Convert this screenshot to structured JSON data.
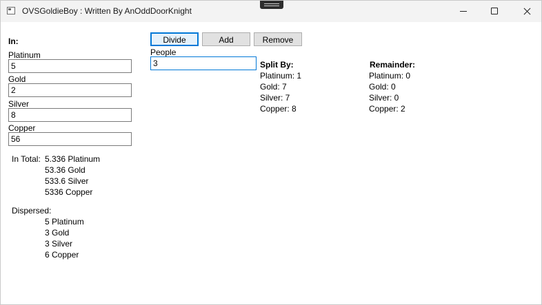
{
  "window": {
    "title": "OVSGoldieBoy : Written By AnOddDoorKnight"
  },
  "input_panel": {
    "heading": "In:",
    "fields": [
      {
        "label": "Platinum",
        "value": "5"
      },
      {
        "label": "Gold",
        "value": "2"
      },
      {
        "label": "Silver",
        "value": "8"
      },
      {
        "label": "Copper",
        "value": "56"
      }
    ]
  },
  "totals": {
    "label": "In Total:",
    "lines": [
      "5.336 Platinum",
      "53.36 Gold",
      "533.6 Silver",
      "5336 Copper"
    ]
  },
  "dispersed": {
    "label": "Dispersed:",
    "lines": [
      "5 Platinum",
      "3 Gold",
      "3 Silver",
      "6 Copper"
    ]
  },
  "toolbar": {
    "divide_label": "Divide",
    "add_label": "Add",
    "remove_label": "Remove"
  },
  "people": {
    "label": "People",
    "value": "3"
  },
  "split_by": {
    "heading": "Split By:",
    "lines": [
      "Platinum: 1",
      "Gold: 7",
      "Silver: 7",
      "Copper: 8"
    ]
  },
  "remainder": {
    "heading": "Remainder:",
    "lines": [
      "Platinum: 0",
      "Gold: 0",
      "Silver: 0",
      "Copper: 2"
    ]
  }
}
